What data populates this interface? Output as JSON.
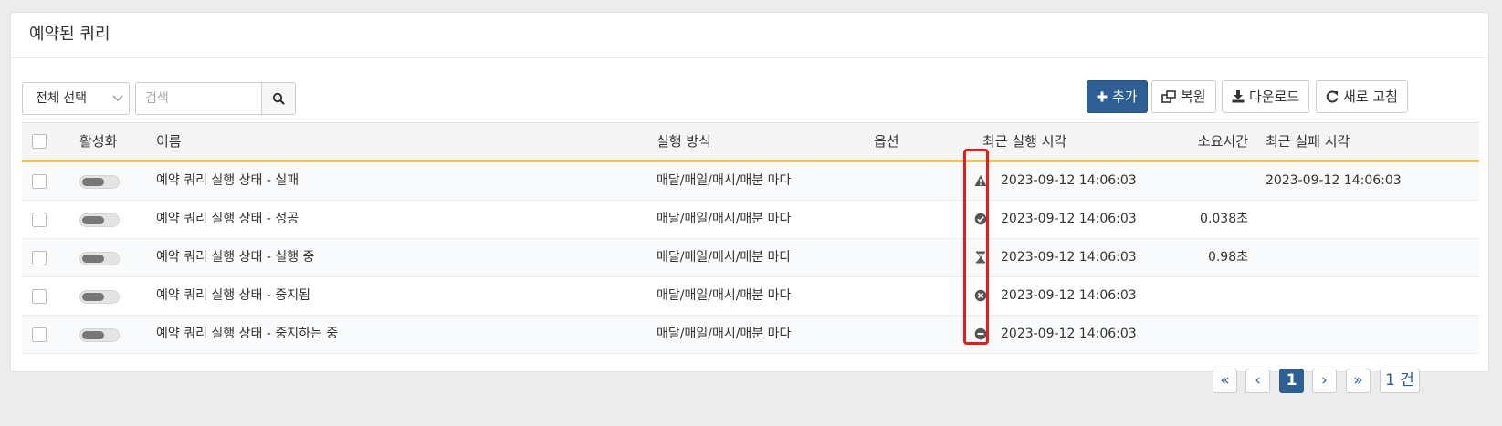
{
  "panel": {
    "title": "예약된 쿼리"
  },
  "toolbar": {
    "select_label": "전체 선택",
    "search_placeholder": "검색",
    "add_label": "추가",
    "restore_label": "복원",
    "download_label": "다운로드",
    "refresh_label": "새로 고침"
  },
  "table": {
    "headers": {
      "active": "활성화",
      "name": "이름",
      "method": "실행 방식",
      "options": "옵션",
      "last_run": "최근 실행 시각",
      "duration": "소요시간",
      "last_fail": "최근 실패 시각"
    },
    "rows": [
      {
        "name": "예약 쿼리 실행 상태 - 실패",
        "method": "매달/매일/매시/매분 마다",
        "status_icon": "warning-icon",
        "last_run": "2023-09-12 14:06:03",
        "duration": "",
        "last_fail": "2023-09-12 14:06:03"
      },
      {
        "name": "예약 쿼리 실행 상태 - 성공",
        "method": "매달/매일/매시/매분 마다",
        "status_icon": "check-circle-icon",
        "last_run": "2023-09-12 14:06:03",
        "duration": "0.038초",
        "last_fail": ""
      },
      {
        "name": "예약 쿼리 실행 상태 - 실행 중",
        "method": "매달/매일/매시/매분 마다",
        "status_icon": "hourglass-icon",
        "last_run": "2023-09-12 14:06:03",
        "duration": "0.98초",
        "last_fail": ""
      },
      {
        "name": "예약 쿼리 실행 상태 - 중지됨",
        "method": "매달/매일/매시/매분 마다",
        "status_icon": "x-circle-icon",
        "last_run": "2023-09-12 14:06:03",
        "duration": "",
        "last_fail": ""
      },
      {
        "name": "예약 쿼리 실행 상태 - 중지하는 중",
        "method": "매달/매일/매시/매분 마다",
        "status_icon": "minus-circle-icon",
        "last_run": "2023-09-12 14:06:03",
        "duration": "",
        "last_fail": ""
      }
    ]
  },
  "pagination": {
    "first": "«",
    "prev": "‹",
    "current": "1",
    "next": "›",
    "last": "»",
    "total": "1 건"
  },
  "colors": {
    "primary": "#2d5f95",
    "highlight": "#e81b1b",
    "header_accent": "#f0c14b"
  }
}
